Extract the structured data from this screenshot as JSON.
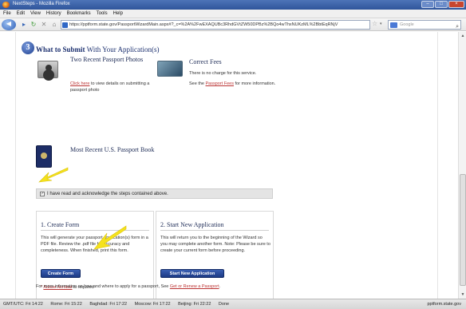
{
  "window": {
    "title": "NextSteps - Mozilla Firefox"
  },
  "menu": [
    "File",
    "Edit",
    "View",
    "History",
    "Bookmarks",
    "Tools",
    "Help"
  ],
  "nav": {
    "url": "https://pptform.state.gov/PassportWizardMain.aspx#?_c=%2A%2FwEXAQUBc3RhdGVtZW50DPBz%2BQo4wThxNUKzML%2BbtEqRNjV",
    "search_placeholder": "Google"
  },
  "section": {
    "number": "3",
    "title_bold": "What to Submit",
    "title_rest": " With Your Application(s)"
  },
  "items": {
    "photos": {
      "title": "Two Recent Passport Photos",
      "link": "Click here",
      "text": " to view details on submitting a passport photo"
    },
    "fees": {
      "title": "Correct Fees",
      "line1": "There is no charge for this service.",
      "see": "See the ",
      "link": "Passport Fees",
      "rest": " for more information."
    },
    "passport": {
      "title": "Most Recent U.S. Passport Book"
    }
  },
  "ack": {
    "checked_mark": "✓",
    "label": "I have read and acknowledge the steps contained above."
  },
  "panels": {
    "create": {
      "title": "1. Create Form",
      "text": "This will generate your passport application(s) form in a PDF file. Review the .pdf file for accuracy and completeness. When finished, print this form.",
      "button": "Create Form",
      "note_ast": "* ",
      "note_link": "Adobe Acrobat",
      "note_rest": " is required"
    },
    "start": {
      "title": "2. Start New Application",
      "text": "This will return you to the beginning of the Wizard so you may complete another form. Note: Please be sure to create your current form before proceeding.",
      "button": "Start New Application"
    }
  },
  "footer": {
    "text": "For more information on how and where to apply for a passport, See ",
    "link": "Get or Renew a Passport",
    "end": "."
  },
  "status": {
    "clocks": [
      "GMT/UTC: Fri 14:22",
      "Rome: Fri 15:22",
      "Baghdad: Fri 17:22",
      "Moscow: Fri 17:22",
      "Beijing: Fri 22:22",
      "Done"
    ],
    "domain": "pptform.state.gov"
  },
  "colors": {
    "accent": "#1d3170",
    "link": "#b33333",
    "arrow": "#f5e21c",
    "button": "#2a4ea0"
  },
  "icons": [
    "firefox-icon",
    "back-icon",
    "forward-icon",
    "reload-icon",
    "stop-icon",
    "home-icon",
    "bookmark-star-icon",
    "search-icon",
    "photo-icon",
    "money-icon",
    "passport-book-icon",
    "arrow-pointer-icon"
  ]
}
